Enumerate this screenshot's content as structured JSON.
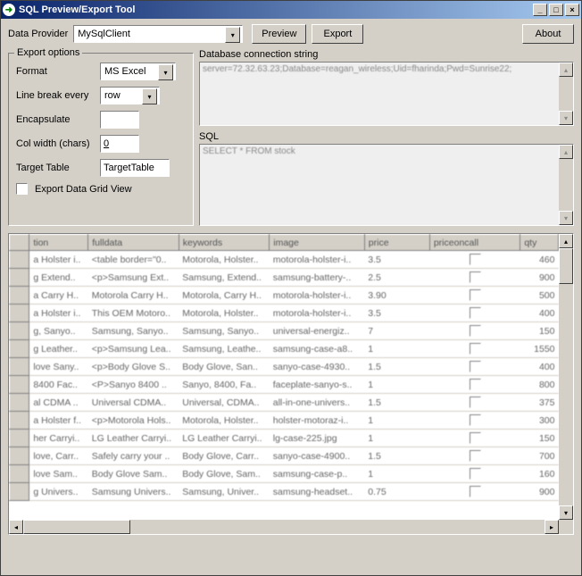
{
  "window": {
    "title": "SQL Preview/Export Tool"
  },
  "top": {
    "provider_label": "Data Provider",
    "provider_value": "MySqlClient",
    "preview_label": "Preview",
    "export_label": "Export",
    "about_label": "About"
  },
  "export_options": {
    "legend": "Export options",
    "format_label": "Format",
    "format_value": "MS Excel",
    "linebreak_label": "Line break every",
    "linebreak_value": "row",
    "encapsulate_label": "Encapsulate",
    "encapsulate_value": "",
    "colwidth_label": "Col width (chars)",
    "colwidth_value": "0",
    "target_label": "Target Table",
    "target_value": "TargetTable",
    "export_grid_label": "Export Data Grid View"
  },
  "conn": {
    "label": "Database connection string",
    "value": "server=72.32.63.23;Database=reagan_wireless;Uid=fharinda;Pwd=Sunrise22;"
  },
  "sql": {
    "label": "SQL",
    "value": "SELECT * FROM stock"
  },
  "grid": {
    "columns": [
      "tion",
      "fulldata",
      "keywords",
      "image",
      "price",
      "priceoncall",
      "qty"
    ],
    "rows": [
      {
        "c": [
          "a Holster i..",
          "<table border=\"0..",
          "Motorola, Holster..",
          "motorola-holster-i..",
          "3.5",
          "",
          "460"
        ]
      },
      {
        "c": [
          "g Extend..",
          "<p>Samsung Ext..",
          "Samsung, Extend..",
          "samsung-battery-..",
          "2.5",
          "",
          "900"
        ]
      },
      {
        "c": [
          "a Carry H..",
          "Motorola Carry H..",
          "Motorola, Carry H..",
          "motorola-holster-i..",
          "3.90",
          "",
          "500"
        ]
      },
      {
        "c": [
          "a Holster i..",
          "This OEM Motoro..",
          "Motorola, Holster..",
          "motorola-holster-i..",
          "3.5",
          "",
          "400"
        ]
      },
      {
        "c": [
          "g, Sanyo..",
          "Samsung, Sanyo..",
          "Samsung, Sanyo..",
          "universal-energiz..",
          "7",
          "",
          "150"
        ]
      },
      {
        "c": [
          "g Leather..",
          "<p>Samsung Lea..",
          "Samsung, Leathe..",
          "samsung-case-a8..",
          "1",
          "",
          "1550"
        ]
      },
      {
        "c": [
          "love Sany..",
          "<p>Body Glove S..",
          "Body Glove, San..",
          "sanyo-case-4930..",
          "1.5",
          "",
          "400"
        ]
      },
      {
        "c": [
          "8400 Fac..",
          "<P>Sanyo 8400 ..",
          "Sanyo, 8400, Fa..",
          "faceplate-sanyo-s..",
          "1",
          "",
          "800"
        ]
      },
      {
        "c": [
          "al CDMA ..",
          "Universal CDMA..",
          "Universal, CDMA..",
          "all-in-one-univers..",
          "1.5",
          "",
          "375"
        ]
      },
      {
        "c": [
          "a Holster f..",
          "<p>Motorola Hols..",
          "Motorola, Holster..",
          "holster-motoraz-i..",
          "1",
          "",
          "300"
        ]
      },
      {
        "c": [
          "her Carryi..",
          "LG Leather Carryi..",
          "LG Leather Carryi..",
          "lg-case-225.jpg",
          "1",
          "",
          "150"
        ]
      },
      {
        "c": [
          "love, Carr..",
          "Safely carry your ..",
          "Body Glove, Carr..",
          "sanyo-case-4900..",
          "1.5",
          "",
          "700"
        ]
      },
      {
        "c": [
          "love Sam..",
          "Body Glove Sam..",
          "Body Glove, Sam..",
          "samsung-case-p..",
          "1",
          "",
          "160"
        ]
      },
      {
        "c": [
          "g Univers..",
          "Samsung Univers..",
          "Samsung, Univer..",
          "samsung-headset..",
          "0.75",
          "",
          "900"
        ]
      }
    ]
  }
}
